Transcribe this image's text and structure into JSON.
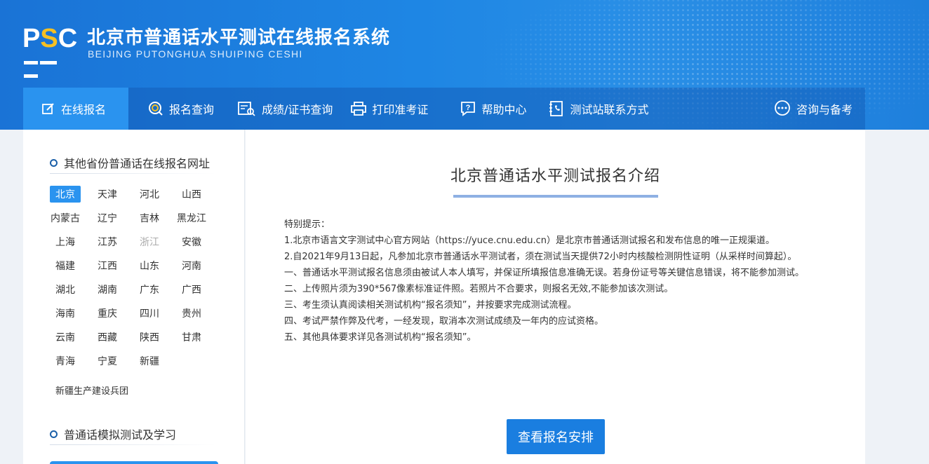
{
  "header": {
    "logo_text_p": "P",
    "logo_text_s": "S",
    "logo_text_c": "C",
    "title": "北京市普通话水平测试在线报名系统",
    "subtitle": "BEIJING PUTONGHUA SHUIPING CESHI"
  },
  "nav": {
    "items": [
      {
        "label": "在线报名",
        "icon": "edit-icon"
      },
      {
        "label": "报名查询",
        "icon": "search-circle-icon"
      },
      {
        "label": "成绩/证书查询",
        "icon": "certificate-search-icon"
      },
      {
        "label": "打印准考证",
        "icon": "printer-icon"
      },
      {
        "label": "帮助中心",
        "icon": "help-icon"
      },
      {
        "label": "测试站联系方式",
        "icon": "phone-book-icon"
      }
    ],
    "consult": {
      "label": "咨询与备考",
      "icon": "chat-bubble-icon"
    }
  },
  "sidebar": {
    "provinces_heading": "其他省份普通话在线报名网址",
    "provinces": [
      "北京",
      "天津",
      "河北",
      "山西",
      "内蒙古",
      "辽宁",
      "吉林",
      "黑龙江",
      "上海",
      "江苏",
      "浙江",
      "安徽",
      "福建",
      "江西",
      "山东",
      "河南",
      "湖北",
      "湖南",
      "广东",
      "广西",
      "海南",
      "重庆",
      "四川",
      "贵州",
      "云南",
      "西藏",
      "陕西",
      "甘肃",
      "青海",
      "宁夏",
      "新疆"
    ],
    "bingtuan": "新疆生产建设兵团",
    "practice_heading": "普通话模拟测试及学习"
  },
  "main": {
    "title": "北京普通话水平测试报名介绍",
    "notice": [
      "特别提示：",
      "1.北京市语言文字测试中心官方网站（https://yuce.cnu.edu.cn）是北京市普通话测试报名和发布信息的唯一正规渠道。",
      "2.自2021年9月13日起，凡参加北京市普通话水平测试者，须在测试当天提供72小时内核酸检测阴性证明（从采样时间算起）。",
      "一、普通话水平测试报名信息须由被试人本人填写，并保证所填报信息准确无误。若身份证号等关键信息错误，将不能参加测试。",
      "二、上传照片须为390*567像素标准证件照。若照片不合要求，则报名无效,不能参加该次测试。",
      "三、考生须认真阅读相关测试机构“报名须知”，并按要求完成测试流程。",
      "四、考试严禁作弊及代考，一经发现，取消本次测试成绩及一年内的应试资格。",
      "五、其他具体要求详见各测试机构“报名须知”。"
    ],
    "cta": "查看报名安排"
  }
}
